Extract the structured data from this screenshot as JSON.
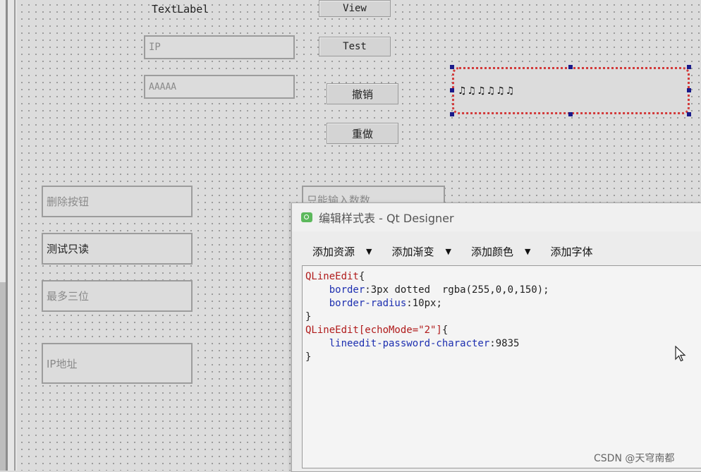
{
  "form": {
    "text_label": "TextLabel",
    "buttons": {
      "view": "View",
      "test": "Test",
      "undo": "撤销",
      "redo": "重做"
    },
    "line_edits": {
      "ip": "IP",
      "aaaaa": "AAAAA",
      "delete_button": "删除按钮",
      "test_readonly": "测试只读",
      "max_three": "最多三位",
      "ip_address": "IP地址",
      "digits_only": "只能输入数数"
    },
    "selected_widget_text": "♫♫♫♫♫♫"
  },
  "dialog": {
    "title": "编辑样式表 - Qt Designer",
    "icon": "qt-designer-icon",
    "toolbar": {
      "add_resource": "添加资源",
      "add_gradient": "添加渐变",
      "add_color": "添加颜色",
      "add_font": "添加字体"
    },
    "code": {
      "sel1": "QLineEdit",
      "brace_open1": "{",
      "prop1": "border",
      "val1": ":3px dotted  rgba(255,0,0,150);",
      "prop2": "border-radius",
      "val2": ":10px;",
      "brace_close1": "}",
      "sel2": "QLineEdit[echoMode=\"2\"]",
      "brace_open2": "{",
      "prop3": "lineedit-password-character",
      "val3": ":9835",
      "brace_close2": "}"
    }
  },
  "watermark": "CSDN @天穹南都",
  "colors": {
    "selector": "#b01b1b",
    "property": "#1d2fb0",
    "selection_border": "#d23a3a"
  }
}
